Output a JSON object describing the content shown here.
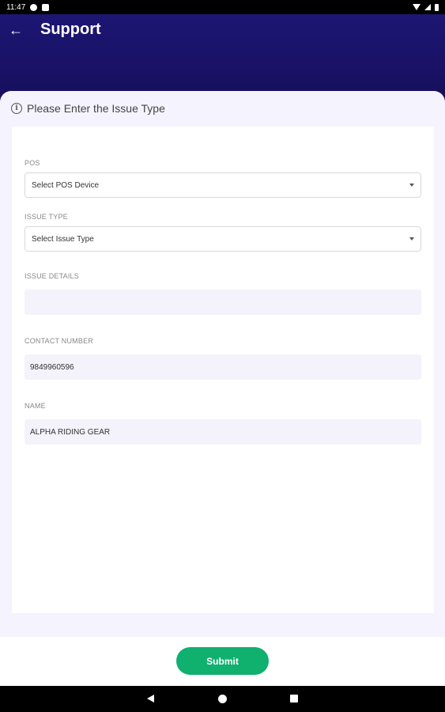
{
  "status_bar": {
    "time": "11:47",
    "icons": [
      "app-notification-icon",
      "sim-card-icon",
      "wifi-icon",
      "signal-icon",
      "battery-icon"
    ]
  },
  "header": {
    "title": "Support",
    "back_icon": "arrow-left-icon"
  },
  "section": {
    "icon": "info-icon",
    "title": "Please Enter the Issue Type"
  },
  "form": {
    "pos": {
      "label": "POS",
      "placeholder": "Select POS Device"
    },
    "issue_type": {
      "label": "ISSUE TYPE",
      "placeholder": "Select Issue Type"
    },
    "issue_details": {
      "label": "ISSUE DETAILS",
      "value": ""
    },
    "contact_number": {
      "label": "CONTACT NUMBER",
      "value": "9849960596"
    },
    "name": {
      "label": "NAME",
      "value": "ALPHA RIDING GEAR"
    }
  },
  "footer": {
    "submit_label": "Submit"
  },
  "colors": {
    "header": "#1d1673",
    "accent": "#10b06f",
    "background": "#f5f3fd"
  }
}
